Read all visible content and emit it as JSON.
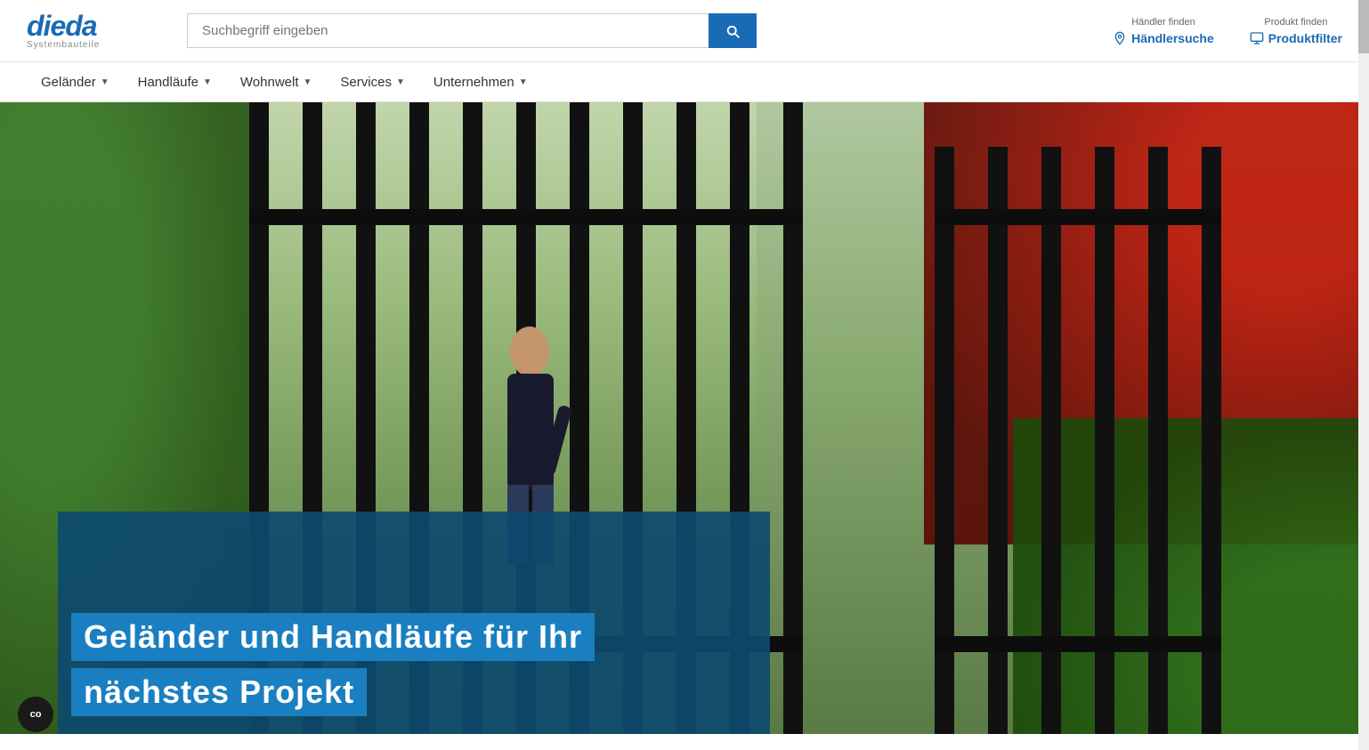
{
  "header": {
    "logo": {
      "brand": "dieda",
      "subtitle": "Systembauteile"
    },
    "search": {
      "placeholder": "Suchbegriff eingeben"
    },
    "actions": {
      "find_dealer": {
        "label": "Händler finden",
        "main": "Händlersuche"
      },
      "find_product": {
        "label": "Produkt finden",
        "main": "Produktfilter"
      }
    }
  },
  "nav": {
    "items": [
      {
        "label": "Geländer",
        "has_dropdown": true
      },
      {
        "label": "Handläufe",
        "has_dropdown": true
      },
      {
        "label": "Wohnwelt",
        "has_dropdown": true
      },
      {
        "label": "Services",
        "has_dropdown": true
      },
      {
        "label": "Unternehmen",
        "has_dropdown": true
      }
    ]
  },
  "hero": {
    "title_line1": "Geländer und Handläufe für Ihr",
    "title_line2": "nächstes Projekt"
  },
  "co_badge": {
    "label": "co"
  },
  "colors": {
    "brand_blue": "#1a6bb5",
    "hero_dark_blue": "#0d4a6e",
    "highlight_blue": "#1a7fc1"
  }
}
